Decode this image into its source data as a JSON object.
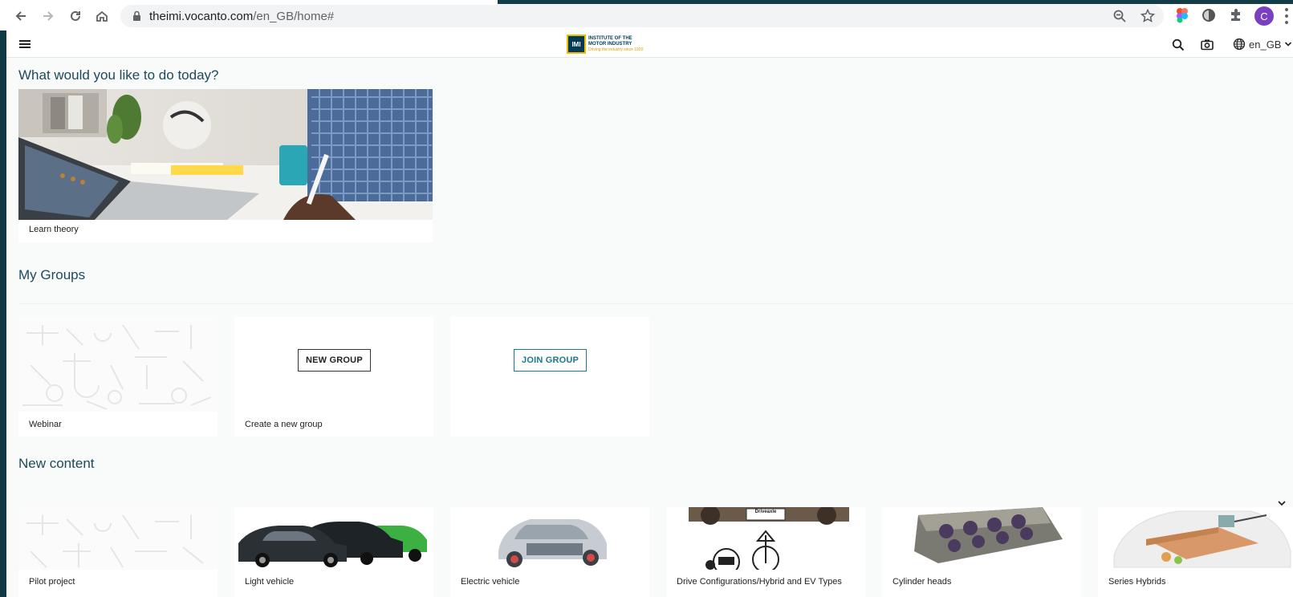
{
  "browser": {
    "url_host": "theimi.vocanto.com",
    "url_path": "/en_GB/home#",
    "profile_initial": "C"
  },
  "header": {
    "logo_badge": "IMI",
    "logo_line1": "INSTITUTE OF THE",
    "logo_line2": "MOTOR INDUSTRY",
    "logo_tagline": "Driving the industry since 1920",
    "language": "en_GB"
  },
  "sections": {
    "intro_title": "What would you like to do today?",
    "groups_title": "My Groups",
    "new_content_title": "New content"
  },
  "hero_card": {
    "label": "Learn theory"
  },
  "groups": {
    "webinar_label": "Webinar",
    "new_group_button": "NEW GROUP",
    "new_group_label": "Create a new group",
    "join_group_button": "JOIN GROUP"
  },
  "new_content": [
    {
      "label": "Pilot project"
    },
    {
      "label": "Light vehicle"
    },
    {
      "label": "Electric vehicle"
    },
    {
      "label": "Drive Configurations/Hybrid and EV Types",
      "image_caption": "Driveaxle"
    },
    {
      "label": "Cylinder heads"
    },
    {
      "label": "Series Hybrids"
    }
  ],
  "colors": {
    "accent_teal": "#1a7a8c",
    "heading": "#1c4a5c",
    "profile": "#7b3fc2"
  }
}
